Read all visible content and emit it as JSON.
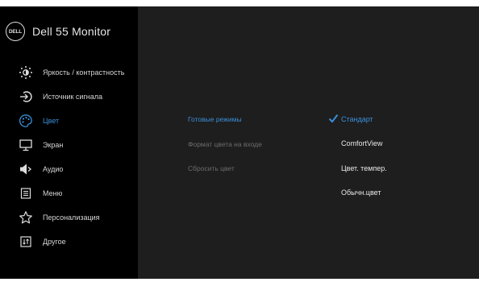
{
  "header": {
    "logo_text": "DELL",
    "title": "Dell 55 Monitor"
  },
  "sidebar": {
    "items": [
      {
        "label": "Яркость / контрастность",
        "icon": "brightness-icon"
      },
      {
        "label": "Источник сигнала",
        "icon": "input-source-icon"
      },
      {
        "label": "Цвет",
        "icon": "palette-icon",
        "active": true
      },
      {
        "label": "Экран",
        "icon": "display-icon"
      },
      {
        "label": "Аудио",
        "icon": "speaker-icon"
      },
      {
        "label": "Меню",
        "icon": "menu-icon"
      },
      {
        "label": "Персонализация",
        "icon": "star-icon"
      },
      {
        "label": "Другое",
        "icon": "other-icon"
      }
    ]
  },
  "submenu": {
    "items": [
      {
        "label": "Готовые режимы",
        "active": true
      },
      {
        "label": "Формат цвета на входе"
      },
      {
        "label": "Сбросить цвет"
      }
    ]
  },
  "options": {
    "items": [
      {
        "label": "Стандарт",
        "selected": true
      },
      {
        "label": "ComfortView"
      },
      {
        "label": "Цвет. темпер."
      },
      {
        "label": "Обычн.цвет"
      }
    ]
  },
  "colors": {
    "accent": "#3a8fd8",
    "panel": "#1e1e1e",
    "sidebar": "#000000"
  }
}
